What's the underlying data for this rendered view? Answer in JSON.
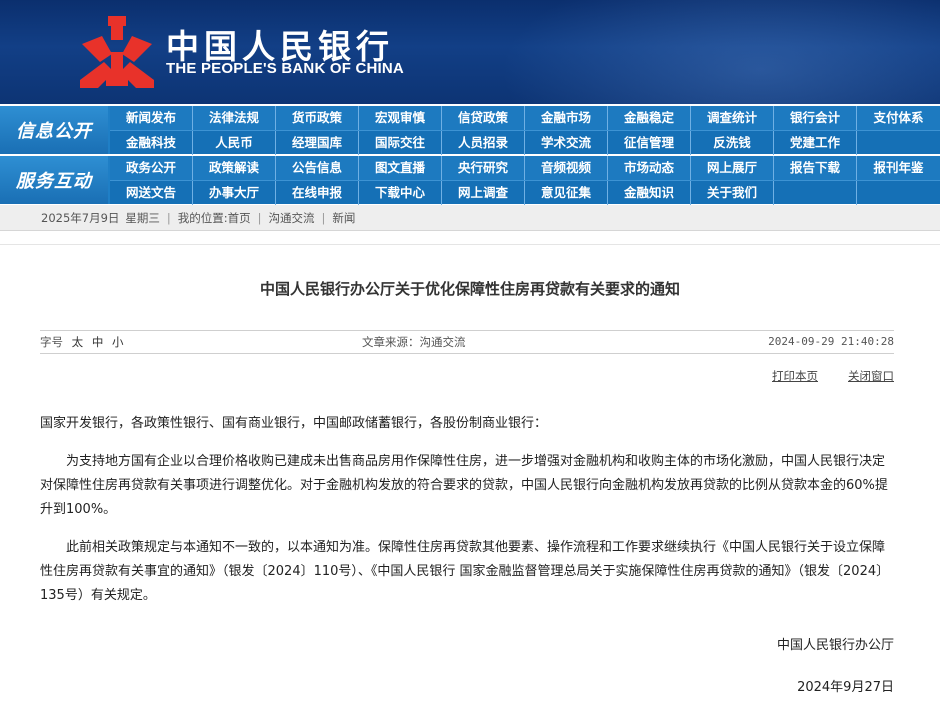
{
  "header": {
    "logo_cn": "中国人民银行",
    "logo_en": "THE PEOPLE'S BANK OF CHINA",
    "emblem_color": "#e8322a",
    "bg_color": "#0f3a7d"
  },
  "nav_info": {
    "label": "信息公开",
    "row1": [
      "新闻发布",
      "法律法规",
      "货币政策",
      "宏观审慎",
      "信贷政策",
      "金融市场",
      "金融稳定",
      "调查统计",
      "银行会计",
      "支付体系"
    ],
    "row2": [
      "金融科技",
      "人民币",
      "经理国库",
      "国际交往",
      "人员招录",
      "学术交流",
      "征信管理",
      "反洗钱",
      "党建工作",
      ""
    ]
  },
  "nav_service": {
    "label": "服务互动",
    "row1": [
      "政务公开",
      "政策解读",
      "公告信息",
      "图文直播",
      "央行研究",
      "音频视频",
      "市场动态",
      "网上展厅",
      "报告下载",
      "报刊年鉴"
    ],
    "row2": [
      "网送文告",
      "办事大厅",
      "在线申报",
      "下载中心",
      "网上调查",
      "意见征集",
      "金融知识",
      "关于我们",
      "",
      ""
    ]
  },
  "breadcrumb": {
    "date": "2025年7月9日",
    "weekday": "星期三",
    "location_prefix": "我的位置:",
    "home": "首页",
    "section": "沟通交流",
    "page": "新闻"
  },
  "article": {
    "title": "中国人民银行办公厅关于优化保障性住房再贷款有关要求的通知",
    "font_size_label": "字号",
    "font_large": "太",
    "font_medium": "中",
    "font_small": "小",
    "source": "文章来源：沟通交流",
    "datetime": "2024-09-29 21:40:28",
    "print_label": "打印本页",
    "close_label": "关闭窗口",
    "salutation": "国家开发银行，各政策性银行、国有商业银行，中国邮政储蓄银行，各股份制商业银行：",
    "para1": "为支持地方国有企业以合理价格收购已建成未出售商品房用作保障性住房，进一步增强对金融机构和收购主体的市场化激励，中国人民银行决定对保障性住房再贷款有关事项进行调整优化。对于金融机构发放的符合要求的贷款，中国人民银行向金融机构发放再贷款的比例从贷款本金的60%提升到100%。",
    "para2": "此前相关政策规定与本通知不一致的，以本通知为准。保障性住房再贷款其他要素、操作流程和工作要求继续执行《中国人民银行关于设立保障性住房再贷款有关事宜的通知》（银发〔2024〕110号）、《中国人民银行 国家金融监督管理总局关于实施保障性住房再贷款的通知》（银发〔2024〕135号）有关规定。",
    "signature": "中国人民银行办公厅",
    "sign_date": "2024年9月27日"
  }
}
